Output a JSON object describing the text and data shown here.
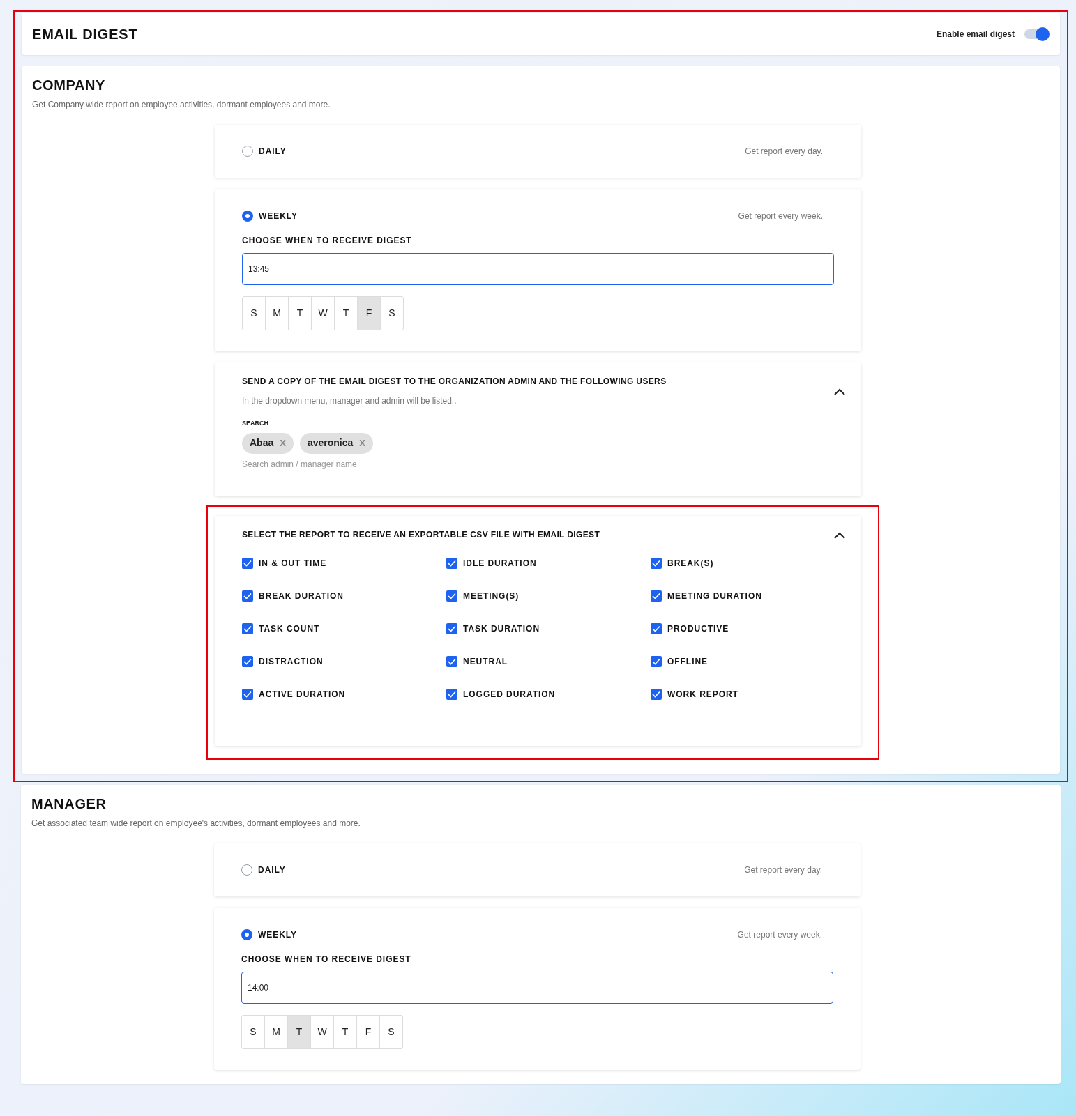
{
  "header": {
    "title": "EMAIL DIGEST",
    "toggle_label": "Enable email digest",
    "enabled": true
  },
  "sections": [
    {
      "title": "COMPANY",
      "subtitle": "Get Company wide report on employee activities, dormant employees and more.",
      "highlighted": true,
      "frequencies": [
        {
          "label": "DAILY",
          "hint": "Get report every day.",
          "selected": false
        },
        {
          "label": "WEEKLY",
          "hint": "Get report every week.",
          "selected": true,
          "time_label": "CHOOSE WHEN TO RECEIVE DIGEST",
          "time": "13:45",
          "days": [
            {
              "label": "S",
              "selected": false
            },
            {
              "label": "M",
              "selected": false
            },
            {
              "label": "T",
              "selected": false
            },
            {
              "label": "W",
              "selected": false
            },
            {
              "label": "T",
              "selected": false
            },
            {
              "label": "F",
              "selected": true
            },
            {
              "label": "S",
              "selected": false
            }
          ]
        }
      ],
      "recipients": {
        "title": "SEND A COPY OF THE EMAIL DIGEST TO THE ORGANIZATION ADMIN AND THE FOLLOWING USERS",
        "description": "In the dropdown menu, manager and admin will be listed..",
        "expanded": true,
        "search_label": "SEARCH",
        "chips": [
          {
            "label": "Abaa",
            "remove": "X"
          },
          {
            "label": "averonica",
            "remove": "X"
          }
        ],
        "placeholder": "Search admin / manager name"
      },
      "csv_report": {
        "title": "SELECT THE REPORT TO RECEIVE AN EXPORTABLE CSV FILE WITH EMAIL DIGEST",
        "expanded": true,
        "highlighted": true,
        "options": [
          {
            "label": "IN & OUT TIME",
            "checked": true
          },
          {
            "label": "IDLE DURATION",
            "checked": true
          },
          {
            "label": "BREAK(S)",
            "checked": true
          },
          {
            "label": "BREAK DURATION",
            "checked": true
          },
          {
            "label": "MEETING(S)",
            "checked": true
          },
          {
            "label": "MEETING DURATION",
            "checked": true
          },
          {
            "label": "TASK COUNT",
            "checked": true
          },
          {
            "label": "TASK DURATION",
            "checked": true
          },
          {
            "label": "PRODUCTIVE",
            "checked": true
          },
          {
            "label": "DISTRACTION",
            "checked": true
          },
          {
            "label": "NEUTRAL",
            "checked": true
          },
          {
            "label": "OFFLINE",
            "checked": true
          },
          {
            "label": "ACTIVE DURATION",
            "checked": true
          },
          {
            "label": "LOGGED DURATION",
            "checked": true
          },
          {
            "label": "WORK REPORT",
            "checked": true
          }
        ]
      }
    },
    {
      "title": "MANAGER",
      "subtitle": "Get associated team wide report on employee's activities, dormant employees and more.",
      "frequencies": [
        {
          "label": "DAILY",
          "hint": "Get report every day.",
          "selected": false
        },
        {
          "label": "WEEKLY",
          "hint": "Get report every week.",
          "selected": true,
          "time_label": "CHOOSE WHEN TO RECEIVE DIGEST",
          "time": "14:00",
          "days": [
            {
              "label": "S",
              "selected": false
            },
            {
              "label": "M",
              "selected": false
            },
            {
              "label": "T",
              "selected": true
            },
            {
              "label": "W",
              "selected": false
            },
            {
              "label": "T",
              "selected": false
            },
            {
              "label": "F",
              "selected": false
            },
            {
              "label": "S",
              "selected": false
            }
          ]
        }
      ]
    }
  ]
}
